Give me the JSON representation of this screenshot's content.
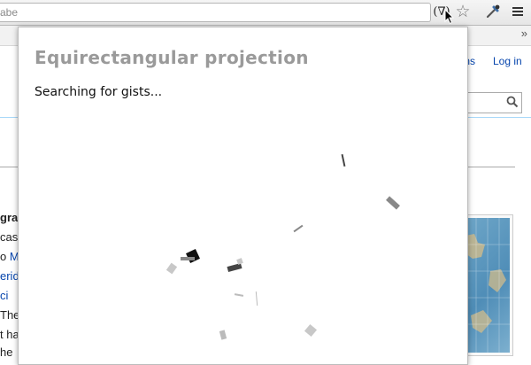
{
  "browser": {
    "url_fragment": "abe",
    "extension_button_label": "(∇)",
    "bookmark_overflow": "»"
  },
  "wiki": {
    "links": [
      "ions",
      "Log in"
    ],
    "text_fragments": [
      {
        "pre": "",
        "bold": "gra",
        "link": "",
        "post": ""
      },
      {
        "pre": "c",
        "bold": "",
        "link": "",
        "post": "as"
      },
      {
        "pre": "o ",
        "bold": "",
        "link": "M",
        "post": ""
      },
      {
        "pre": "",
        "bold": "",
        "link": "erid",
        "post": ""
      },
      {
        "pre": "",
        "bold": "",
        "link": "ci",
        "post": ""
      },
      {
        "pre": "The",
        "bold": "",
        "link": "",
        "post": ""
      },
      {
        "pre": "t ha",
        "bold": "",
        "link": "",
        "post": ""
      },
      {
        "pre": "he",
        "bold": "",
        "link": "",
        "post": ""
      }
    ]
  },
  "popup": {
    "title": "Equirectangular projection",
    "status": "Searching for gists..."
  },
  "loading_marks": {
    "colors": [
      "#222222",
      "#444444",
      "#888888",
      "#bbbbbb",
      "#c8c8c8"
    ]
  }
}
